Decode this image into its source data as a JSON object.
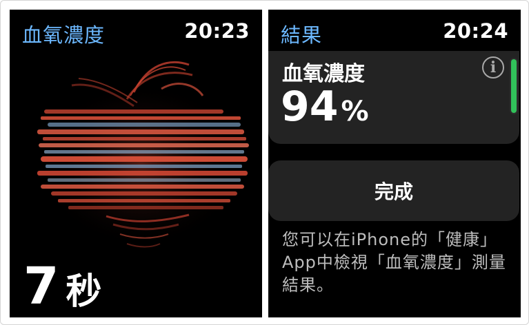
{
  "left_screen": {
    "title": "血氧濃度",
    "time": "20:23",
    "countdown_value": "7",
    "countdown_unit": "秒"
  },
  "right_screen": {
    "title": "結果",
    "time": "20:24",
    "result_label": "血氧濃度",
    "result_value": "94",
    "result_unit": "%",
    "info_icon": "i",
    "done_label": "完成",
    "note": "您可以在iPhone的「健康」App中檢視「血氧濃度」測量結果。"
  },
  "colors": {
    "accent": "#6cb8ff",
    "background": "#000000",
    "card": "#232323",
    "scroll_thumb": "#31c25a",
    "swirl_red": "#e2533c",
    "swirl_blue": "#7a9ec2"
  }
}
